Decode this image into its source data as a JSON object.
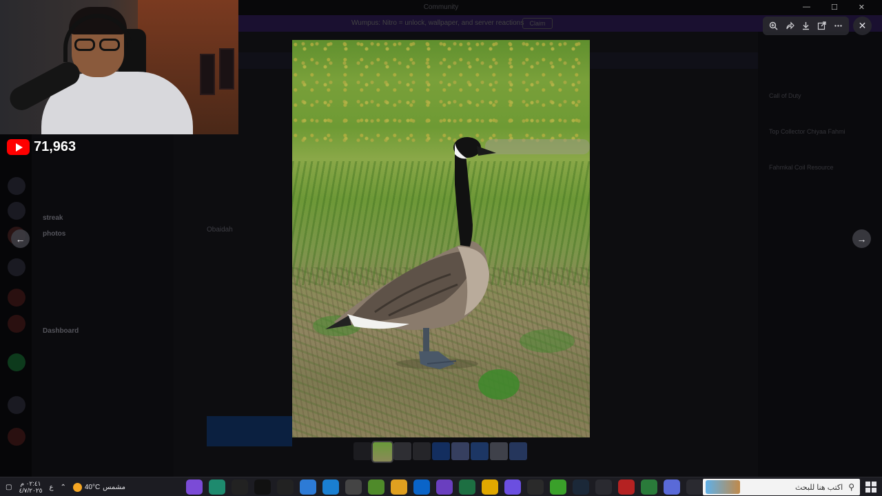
{
  "background_app": {
    "window_title": "Community",
    "banner_text": "Wumpus: Nitro = unlock, wallpaper, and server reactions",
    "banner_button": "Claim",
    "channels": [
      "streak",
      "photos",
      "Dashboard"
    ],
    "message_author": "Obaidah",
    "members": [
      "Call of Duty",
      "Top Collector Chiyaa Fahmi",
      "Fahmkal Coil Resource"
    ]
  },
  "stream": {
    "viewer_count": "71,963"
  },
  "viewer": {
    "toolbar_icons": [
      "zoom-icon",
      "share-icon",
      "download-icon",
      "open-external-icon",
      "more-icon"
    ],
    "close_icon": "close-icon",
    "prev_icon": "arrow-left-icon",
    "next_icon": "arrow-right-icon",
    "thumbnail_count": 9,
    "active_thumbnail": 1
  },
  "taskbar": {
    "clock_time": "٠٢:٤١ م",
    "clock_date": "٤/٧/٢٠٢٥",
    "language": "ع",
    "weather_temp": "40°C",
    "weather_label": "مشمس",
    "search_placeholder": "اكتب هنا للبحث",
    "apps": [
      {
        "icon": "nitro-app-icon",
        "color": "#7b4bd6"
      },
      {
        "icon": "streamlabs-icon",
        "color": "#1e8a6e"
      },
      {
        "icon": "capcut-icon",
        "color": "#222222"
      },
      {
        "icon": "tiktok-icon",
        "color": "#111111"
      },
      {
        "icon": "openai-icon",
        "color": "#222222"
      },
      {
        "icon": "weather-icon",
        "color": "#2d7bd6"
      },
      {
        "icon": "edge-icon",
        "color": "#1a7fd1"
      },
      {
        "icon": "cursor-icon",
        "color": "#444444"
      },
      {
        "icon": "minecraft-icon",
        "color": "#4f8a2a"
      },
      {
        "icon": "file-explorer-icon",
        "color": "#e0a020"
      },
      {
        "icon": "outlook-icon",
        "color": "#0a64c8"
      },
      {
        "icon": "obs-icon",
        "color": "#6a3fbf"
      },
      {
        "icon": "excel-icon",
        "color": "#1d6f42"
      },
      {
        "icon": "rockstar-icon",
        "color": "#e0a800"
      },
      {
        "icon": "app-grid-icon",
        "color": "#6b4fe0"
      },
      {
        "icon": "epic-games-icon",
        "color": "#2a2a2a"
      },
      {
        "icon": "nvidia-icon",
        "color": "#3aa02a"
      },
      {
        "icon": "steam-icon",
        "color": "#1b2838"
      },
      {
        "icon": "discord-icon",
        "color": "#2a2a30"
      },
      {
        "icon": "browser-red-icon",
        "color": "#b52222"
      },
      {
        "icon": "chrome-icon",
        "color": "#2a7a3a"
      },
      {
        "icon": "copilot-icon",
        "color": "#5a6ad8"
      },
      {
        "icon": "snipping-tool-icon",
        "color": "#2a2a30"
      }
    ]
  }
}
